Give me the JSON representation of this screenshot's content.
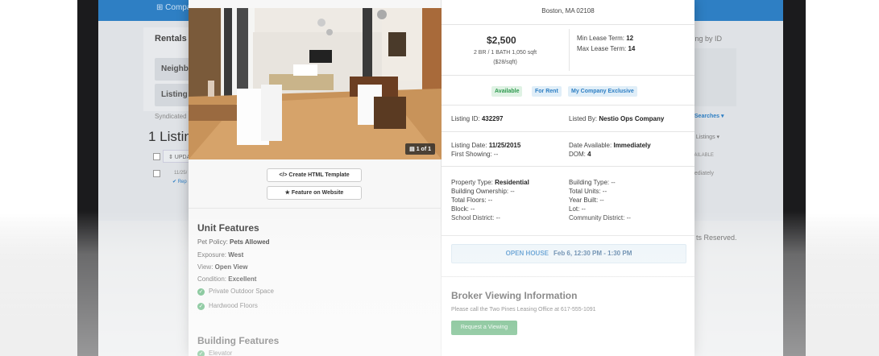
{
  "background_app": {
    "topbar_label": "⊞ Compa",
    "rentals_title": "Rentals",
    "neighborhood_pill": "Neighb",
    "listing_pill": "Listing",
    "syndicated_label": "Syndicated",
    "listings_count": "1 Listin",
    "table_header": "⇕ UPDA",
    "row_date": "11/25/",
    "row_report": "✔ Rep",
    "by_id_label": "ting by ID",
    "searches_label": "l Searches ▾",
    "listings_dropdown": "d Listings ▾",
    "available_col": "VAILABLE",
    "immediately_cell": "nediately",
    "footer_text": "ts Reserved."
  },
  "gallery": {
    "counter": "▤ 1 of 1"
  },
  "actions": {
    "create_html": "</> Create HTML Template",
    "feature_website": "★ Feature on Website"
  },
  "unit_features": {
    "title": "Unit Features",
    "items": [
      {
        "label": "Pet Policy:",
        "value": "Pets Allowed"
      },
      {
        "label": "Exposure:",
        "value": "West"
      },
      {
        "label": "View:",
        "value": "Open View"
      },
      {
        "label": "Condition:",
        "value": "Excellent"
      }
    ],
    "checks": [
      "Private Outdoor Space",
      "Hardwood Floors"
    ]
  },
  "building_features": {
    "title": "Building Features",
    "first_item": "Elevator"
  },
  "listing": {
    "address": "Boston, MA 02108",
    "price": "$2,500",
    "details": "2 BR / 1 BATH 1,050 sqft",
    "price_per_sqft": "($28/sqft)",
    "min_lease_label": "Min Lease Term:",
    "min_lease_value": "12",
    "max_lease_label": "Max Lease Term:",
    "max_lease_value": "14",
    "badges": [
      "Available",
      "For Rent",
      "My Company Exclusive"
    ],
    "listing_id_label": "Listing ID:",
    "listing_id_value": "432297",
    "listed_by_label": "Listed By:",
    "listed_by_value": "Nestio Ops Company",
    "listing_date_label": "Listing Date:",
    "listing_date_value": "11/25/2015",
    "first_showing_label": "First Showing:",
    "first_showing_value": "--",
    "date_available_label": "Date Available:",
    "date_available_value": "Immediately",
    "dom_label": "DOM:",
    "dom_value": "4",
    "property_type_label": "Property Type:",
    "property_type_value": "Residential",
    "building_ownership": "Building Ownership: --",
    "total_floors": "Total Floors: --",
    "block": "Block: --",
    "school_district": "School District: --",
    "building_type": "Building Type: --",
    "total_units": "Total Units: --",
    "year_built": "Year Built: --",
    "lot": "Lot: --",
    "community_district": "Community District: --"
  },
  "open_house": {
    "label": "OPEN HOUSE",
    "time": "Feb 6, 12:30 PM - 1:30 PM"
  },
  "broker": {
    "title": "Broker Viewing Information",
    "text": "Please call the Two Pines Leasing Office at 617-555-1091",
    "button": "Request a Viewing"
  }
}
